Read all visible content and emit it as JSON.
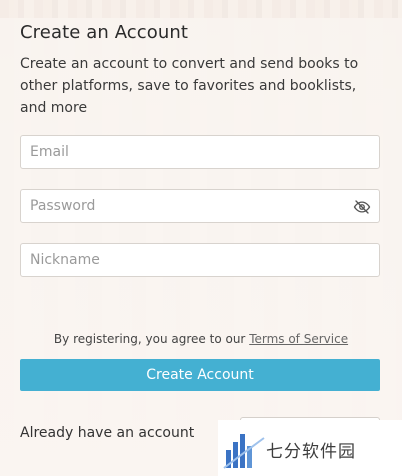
{
  "form": {
    "title": "Create an Account",
    "subtitle": "Create an account to convert and send books to other platforms, save to favorites and booklists, and more",
    "email_placeholder": "Email",
    "password_placeholder": "Password",
    "nickname_placeholder": "Nickname",
    "password_toggle_icon": "eye-off-icon",
    "terms_prefix": "By registering, you agree to our ",
    "terms_link": "Terms of Service",
    "submit_label": "Create Account",
    "already_text": "Already have an account"
  },
  "watermark": {
    "text": "七分软件园",
    "icon": "bar-chart-logo"
  },
  "colors": {
    "accent": "#44b0d2",
    "watermark_blue": "#3b73c4"
  }
}
